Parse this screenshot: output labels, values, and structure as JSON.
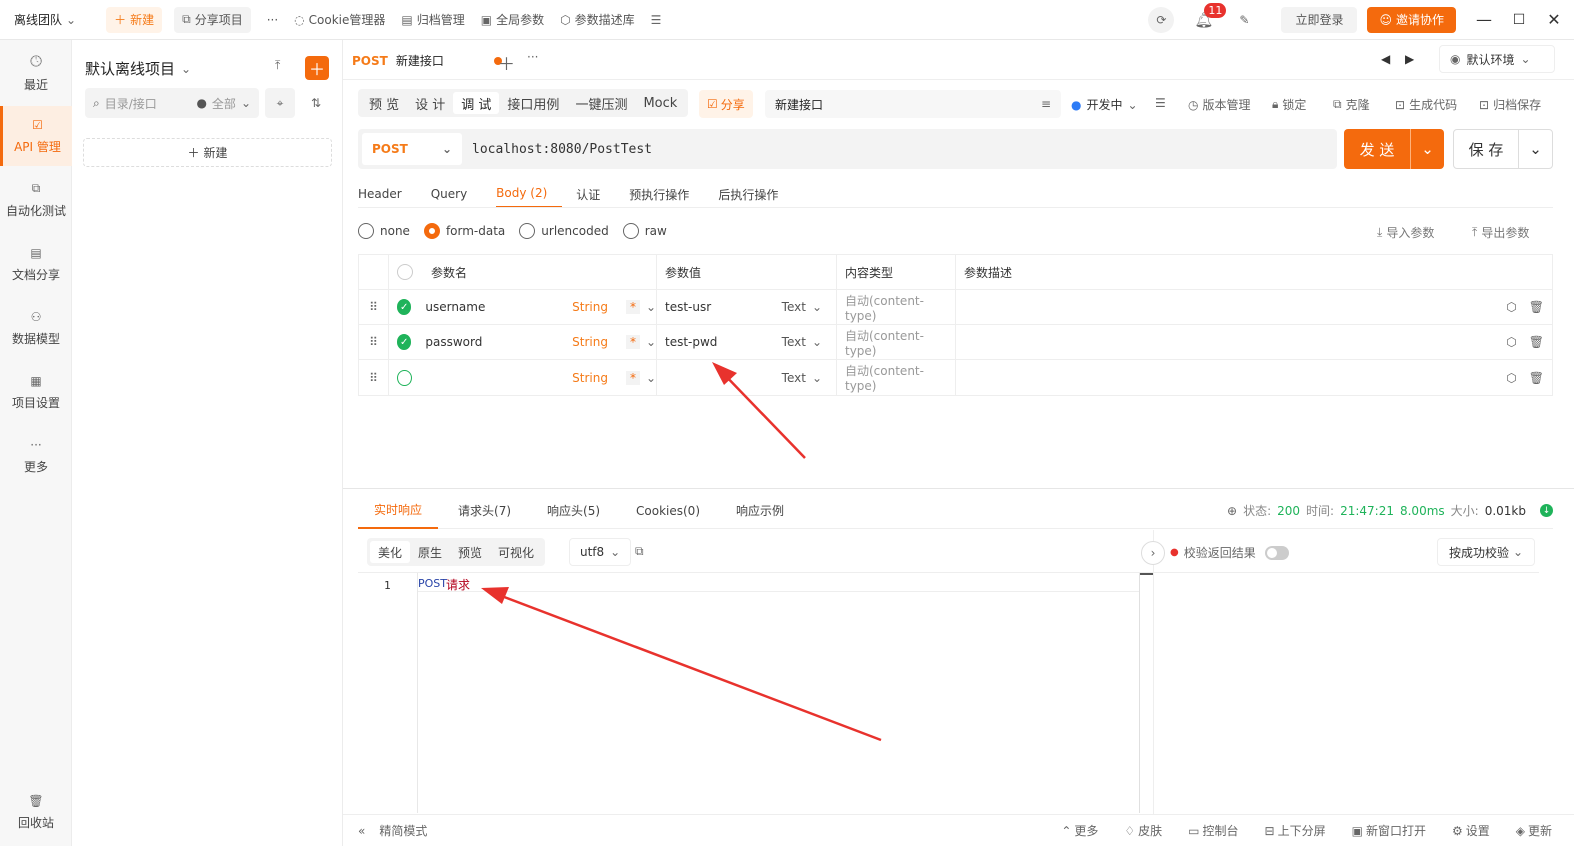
{
  "titlebar": {
    "team": "离线团队",
    "new_label": "新建",
    "share_label": "分享项目",
    "more": "···",
    "cookie_label": "Cookie管理器",
    "archive_label": "归档管理",
    "global_params_label": "全局参数",
    "param_desc_label": "参数描述库",
    "notif_count": "11",
    "login_label": "立即登录",
    "invite_label": "邀请协作"
  },
  "leftnav": {
    "items": [
      {
        "label": "最近",
        "icon": "clock-icon"
      },
      {
        "label": "API 管理",
        "icon": "api-icon"
      },
      {
        "label": "自动化测试",
        "icon": "automation-icon"
      },
      {
        "label": "文档分享",
        "icon": "doc-icon"
      },
      {
        "label": "数据模型",
        "icon": "model-icon"
      },
      {
        "label": "项目设置",
        "icon": "settings-icon"
      },
      {
        "label": "更多",
        "icon": "more-icon"
      }
    ],
    "trash_label": "回收站"
  },
  "project": {
    "name": "默认离线项目",
    "search_placeholder": "目录/接口",
    "filter_label": "全部",
    "new_label": "新建"
  },
  "tab": {
    "method": "POST",
    "name": "新建接口",
    "env_label": "默认环境"
  },
  "subtabs": [
    "预 览",
    "设 计",
    "调 试",
    "接口用例",
    "一键压测",
    "Mock"
  ],
  "share_label": "分享",
  "api_name": "新建接口",
  "status_label": "开发中",
  "toolbar": {
    "version": "版本管理",
    "lock": "锁定",
    "clone": "克隆",
    "codegen": "生成代码",
    "archive": "归档保存"
  },
  "request": {
    "method": "POST",
    "url": "localhost:8080/PostTest",
    "send_label": "发 送",
    "save_label": "保 存"
  },
  "reqtabs": [
    "Header",
    "Query",
    "Body (2)",
    "认证",
    "预执行操作",
    "后执行操作"
  ],
  "body_types": [
    "none",
    "form-data",
    "urlencoded",
    "raw"
  ],
  "import_label": "导入参数",
  "export_label": "导出参数",
  "table": {
    "headers": [
      "参数名",
      "参数值",
      "内容类型",
      "参数描述"
    ],
    "rows": [
      {
        "name": "username",
        "type": "String",
        "required": "*",
        "value": "test-usr",
        "vtype": "Text",
        "ctype": "自动(content-type)"
      },
      {
        "name": "password",
        "type": "String",
        "required": "*",
        "value": "test-pwd",
        "vtype": "Text",
        "ctype": "自动(content-type)"
      },
      {
        "name": "",
        "type": "String",
        "required": "*",
        "value": "",
        "vtype": "Text",
        "ctype": "自动(content-type)"
      }
    ]
  },
  "response": {
    "tabs": [
      "实时响应",
      "请求头(7)",
      "响应头(5)",
      "Cookies(0)",
      "响应示例"
    ],
    "status_label": "状态:",
    "status": "200",
    "time_label": "时间:",
    "time": "21:47:21",
    "duration": "8.00ms",
    "size_label": "大小:",
    "size": "0.01kb",
    "formats": [
      "美化",
      "原生",
      "预览",
      "可视化"
    ],
    "encoding": "utf8",
    "line_no": "1",
    "body_prefix": "POST",
    "body_text": "请求",
    "validate_label": "校验返回结果",
    "validate_mode": "按成功校验"
  },
  "footer": {
    "simple_mode": "精简模式",
    "more": "更多",
    "skin": "皮肤",
    "console": "控制台",
    "split": "上下分屏",
    "new_window": "新窗口打开",
    "settings": "设置",
    "update": "更新"
  },
  "colors": {
    "accent": "#f46a0d",
    "success": "#1fb35a",
    "arrow": "#e8322d"
  }
}
